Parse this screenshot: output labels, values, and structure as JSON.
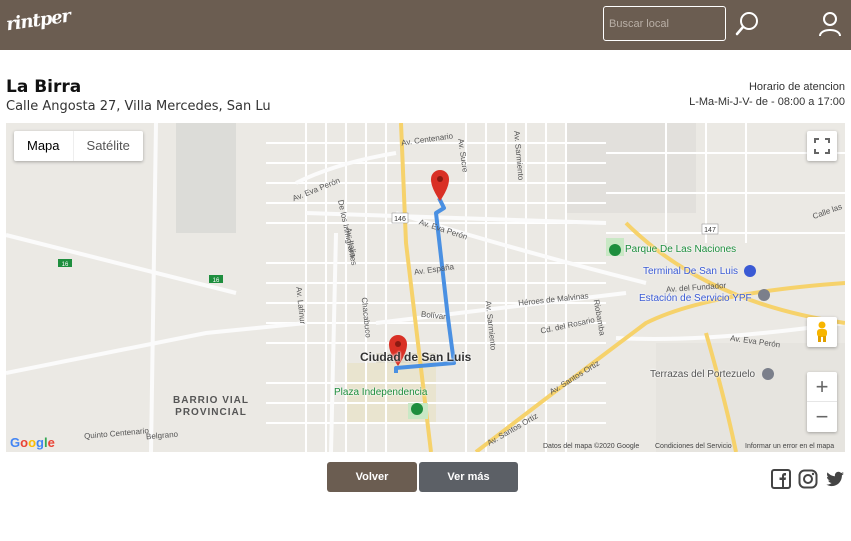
{
  "header": {
    "logo_text": "rintper",
    "search_placeholder": "Buscar local"
  },
  "place": {
    "name": "La Birra",
    "address": "Calle Angosta 27, Villa Mercedes, San Lu",
    "hours_label": "Horario de atencion",
    "hours_value": "L-Ma-Mi-J-V- de - 08:00 a 17:00"
  },
  "map": {
    "type_map": "Mapa",
    "type_satellite": "Satélite",
    "zoom_in": "+",
    "zoom_out": "−",
    "labels": {
      "av_centenario": "Av. Centenario",
      "av_sucre": "Av. Sucre",
      "av_sarmiento": "Av. Sarmiento",
      "av_eva_peron": "Av. Eva Perón",
      "de_los_inmigrantes": "De los Inmigrantes",
      "av_italia": "Av. Italia",
      "av_espana": "Av. España",
      "heroes_malvinas": "Héroes de Malvinas",
      "cd_rosario": "Cd. del Rosario",
      "av_del_fundador": "Av. del Fundador",
      "av_lafinur": "Av. Lafinur",
      "chacabuco": "Chacabuco",
      "bolivar": "Bolívar",
      "rioja": "Riobamba",
      "av_santos_ortiz": "Av. Santos Ortiz",
      "quinto_centenario": "Quinto Centenario",
      "belgrano": "Belgrano",
      "calle_las": "Calle las",
      "av_eva_peron_e": "Av. Eva Perón",
      "route_16": "16",
      "route_146": "146",
      "route_147": "147"
    },
    "city": "Ciudad de San Luis",
    "barrio": "BARRIO VIAL PROVINCIAL",
    "poi": {
      "parque": "Parque De Las Naciones",
      "terminal": "Terminal De San Luis",
      "ypf": "Estación de Servicio YPF",
      "plaza": "Plaza Independencia",
      "terrazas": "Terrazas del Portezuelo"
    },
    "footer": {
      "data": "Datos del mapa ©2020 Google",
      "terms": "Condiciones del Servicio",
      "report": "Informar un error en el mapa"
    },
    "google_logo": "Google",
    "colors": {
      "route": "#4a90e2",
      "marker": "#d93025",
      "park": "#0f9d58",
      "transit": "#3a5ad4"
    }
  },
  "actions": {
    "back": "Volver",
    "more": "Ver más"
  },
  "social": [
    "facebook-icon",
    "instagram-icon",
    "twitter-icon"
  ]
}
